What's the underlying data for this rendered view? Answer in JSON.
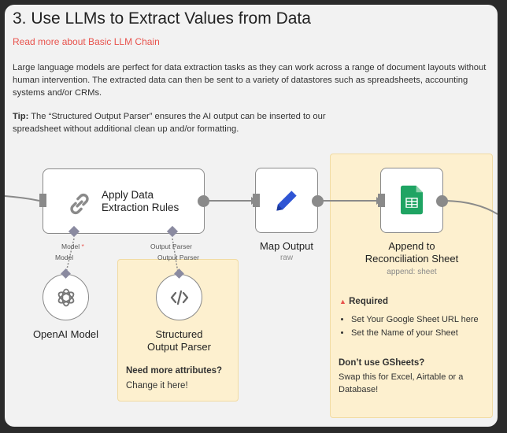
{
  "header": {
    "title": "3. Use LLMs to Extract Values from Data",
    "link": "Read more about Basic LLM Chain",
    "paragraph": "Large language models are perfect for data extraction tasks as they can work across a range of document layouts without human intervention. The extracted data can then be sent to a variety of datastores such as spreadsheets, accounting systems and/or CRMs.",
    "tip_label": "Tip:",
    "tip_text": " The “Structured Output Parser” ensures the AI output can be inserted to our spreadsheet without additional clean up and/or formatting."
  },
  "nodes": {
    "extract": {
      "title_line1": "Apply Data",
      "title_line2": "Extraction Rules"
    },
    "map": {
      "title": "Map Output",
      "subtitle": "raw"
    },
    "append": {
      "title_line1": "Append to",
      "title_line2": "Reconciliation Sheet",
      "subtitle": "append: sheet"
    },
    "openai": {
      "title": "OpenAI Model"
    },
    "parser": {
      "title_line1": "Structured",
      "title_line2": "Output Parser"
    }
  },
  "ports": {
    "model_label": "Model",
    "model_required": "*",
    "model_below": "Model",
    "parser_label": "Output Parser",
    "parser_below": "Output Parser"
  },
  "notes": {
    "parser": {
      "heading": "Need more attributes?",
      "text": "Change it here!"
    },
    "sheet": {
      "required_heading": "Required",
      "items": [
        "Set Your Google Sheet URL here",
        "Set the Name of your Sheet"
      ],
      "alt_heading": "Don’t use GSheets?",
      "alt_text": "Swap this for Excel, Airtable or a Database!"
    }
  },
  "colors": {
    "accent_red": "#e8534d",
    "sticky_bg": "#fdf0cf",
    "pen_blue": "#2f55d4",
    "sheets_green": "#1fa463"
  }
}
